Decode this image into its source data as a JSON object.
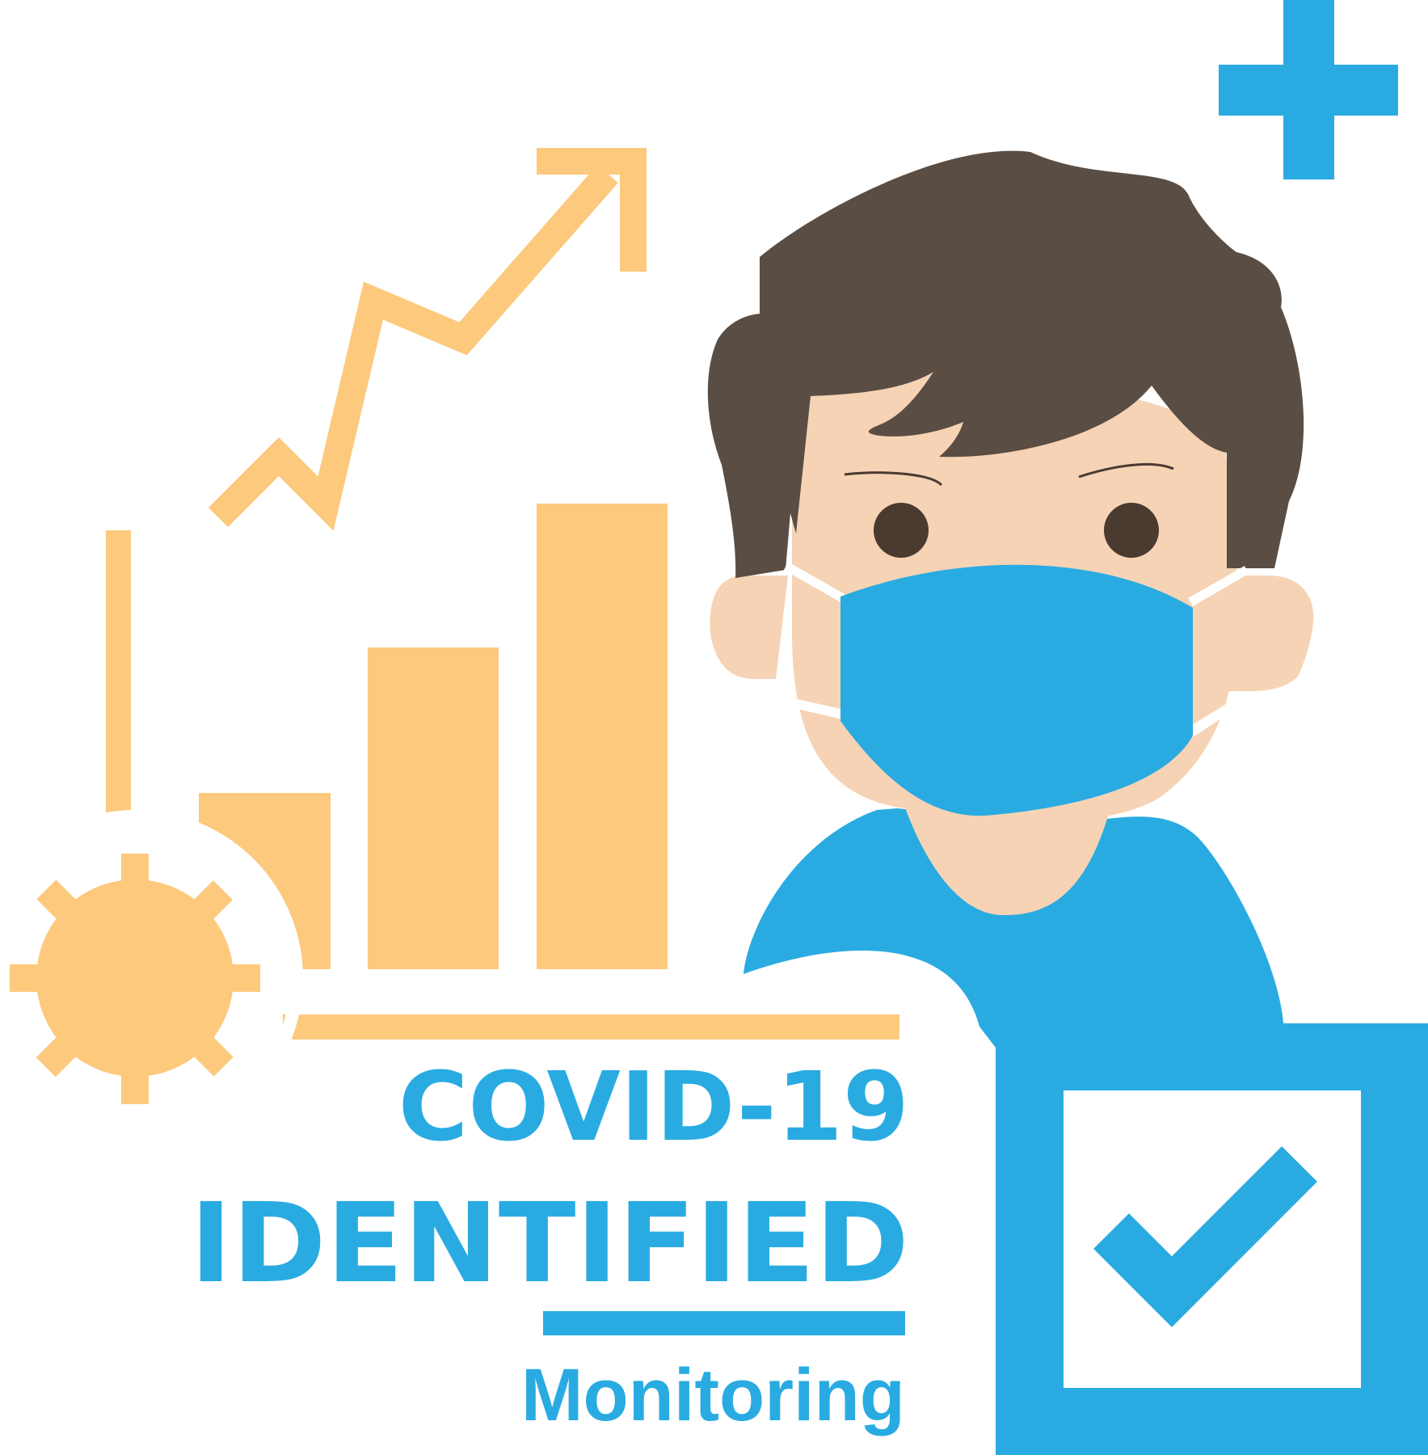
{
  "poster": {
    "title_line1": "COVID-19",
    "title_line2": "IDENTIFIED",
    "subtitle": "Monitoring"
  },
  "colors": {
    "accent_blue": "#29abe2",
    "chart_orange": "#fcc97d",
    "hair_brown": "#5a4d43",
    "skin": "#f6d3b5",
    "eye_dark": "#4a3a30",
    "background": "#ffffff"
  },
  "icons": [
    "plus-icon",
    "virus-icon",
    "trend-arrow-icon",
    "checkbox-icon",
    "checkmark-icon",
    "masked-person-illustration"
  ],
  "bar_levels": [
    0.296,
    0.542,
    0.783
  ]
}
